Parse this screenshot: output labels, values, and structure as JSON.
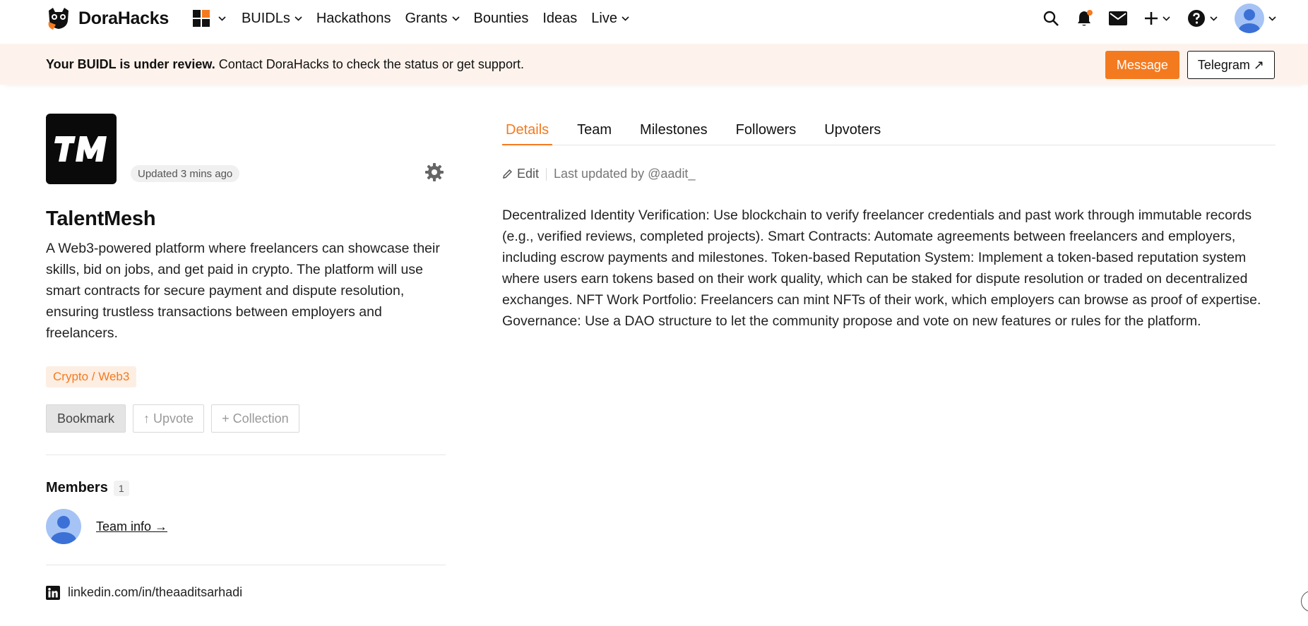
{
  "brand": {
    "name": "DoraHacks",
    "accent": "#f47a1f"
  },
  "nav": {
    "items": [
      {
        "label": "BUIDLs",
        "has_menu": true
      },
      {
        "label": "Hackathons",
        "has_menu": false
      },
      {
        "label": "Grants",
        "has_menu": true
      },
      {
        "label": "Bounties",
        "has_menu": false
      },
      {
        "label": "Ideas",
        "has_menu": false
      },
      {
        "label": "Live",
        "has_menu": true
      }
    ],
    "right_icons": [
      "search-icon",
      "bell-icon",
      "mail-icon",
      "plus-icon",
      "help-icon",
      "avatar"
    ]
  },
  "banner": {
    "bold": "Your BUIDL is under review.",
    "text": "Contact DoraHacks to check the status or get support.",
    "message_label": "Message",
    "telegram_label": "Telegram ↗"
  },
  "project": {
    "updated": "Updated 3 mins ago",
    "name": "TalentMesh",
    "description": "A Web3-powered platform where freelancers can showcase their skills, bid on jobs, and get paid in crypto. The platform will use smart contracts for secure payment and dispute resolution, ensuring trustless transactions between employers and freelancers.",
    "tag": "Crypto / Web3",
    "actions": {
      "bookmark": "Bookmark",
      "upvote": "↑ Upvote",
      "collection": "+ Collection"
    },
    "members_title": "Members",
    "members_count": "1",
    "team_link": "Team info →",
    "linkedin": "linkedin.com/in/theaaditsarhadi"
  },
  "tabs": [
    {
      "label": "Details",
      "active": true
    },
    {
      "label": "Team",
      "active": false
    },
    {
      "label": "Milestones",
      "active": false
    },
    {
      "label": "Followers",
      "active": false
    },
    {
      "label": "Upvoters",
      "active": false
    }
  ],
  "details": {
    "edit_label": "Edit",
    "last_updated": "Last updated by @aadit_",
    "body": "Decentralized Identity Verification: Use blockchain to verify freelancer credentials and past work through immutable records (e.g., verified reviews, completed projects). Smart Contracts: Automate agreements between freelancers and employers, including escrow payments and milestones. Token-based Reputation System: Implement a token-based reputation system where users earn tokens based on their work quality, which can be staked for dispute resolution or traded on decentralized exchanges. NFT Work Portfolio: Freelancers can mint NFTs of their work, which employers can browse as proof of expertise. Governance: Use a DAO structure to let the community propose and vote on new features or rules for the platform."
  }
}
